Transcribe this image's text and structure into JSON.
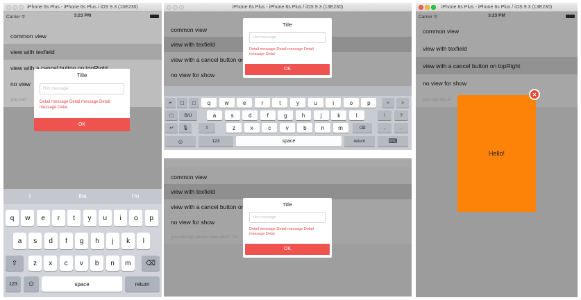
{
  "window_title": "iPhone 6s Plus - iPhone 6s Plus / iOS 9.3 (13E230)",
  "status": {
    "carrier": "Carrier ᯤ",
    "time": "3:23 PM"
  },
  "list_items": [
    "common view",
    "view with texfield",
    "view with a cancel button on topRight",
    "no view for show"
  ],
  "list_truncated": {
    "panel1_row3": "view with a cancel button on topRight",
    "panel2_row3": "view with a cancel button on t",
    "panel1_row4": "no view",
    "panel3_row3": "view with a cancel button on t"
  },
  "hint_text": "you can tap above rows when I'm",
  "hint_short": {
    "panel1": "you can",
    "panel4": "you can tap at"
  },
  "alert": {
    "title": "Title",
    "placeholder": "Hint message",
    "message": "Detail message Detail message Detail message Detai",
    "ok_label": "OK"
  },
  "popup": {
    "text": "Hello!",
    "close_glyph": "✕"
  },
  "colors": {
    "accent": "#ef5350",
    "message": "#e5484d",
    "popup": "#fd8208",
    "selected_row": "#a6a6a6"
  },
  "keyboard_iphone": {
    "suggestions": [
      "I",
      "the",
      "I'm"
    ],
    "row1": [
      "q",
      "w",
      "e",
      "r",
      "t",
      "y",
      "u",
      "i",
      "o",
      "p"
    ],
    "row2": [
      "a",
      "s",
      "d",
      "f",
      "g",
      "h",
      "j",
      "k",
      "l"
    ],
    "row3": [
      "z",
      "x",
      "c",
      "v",
      "b",
      "n",
      "m"
    ],
    "shift": "⇧",
    "backspace": "⌫",
    "numbers": "123",
    "emoji": "☺",
    "space": "space",
    "return": "return"
  },
  "keyboard_ipad": {
    "row1": [
      "q",
      "w",
      "e",
      "r",
      "t",
      "y",
      "u",
      "i",
      "o",
      "p"
    ],
    "row1_left": [
      "✂",
      "▢",
      "▢"
    ],
    "row1_right": [
      "<",
      ">"
    ],
    "row2": [
      "a",
      "s",
      "d",
      "f",
      "g",
      "h",
      "j",
      "k",
      "l"
    ],
    "row2_left": [
      "▢",
      "B/U"
    ],
    "row2_right": [
      "!",
      "?"
    ],
    "row3": [
      "z",
      "x",
      "c",
      "v",
      "b",
      "n",
      "m"
    ],
    "row3_left": [
      "↩",
      "🎙",
      "⇧"
    ],
    "row3_right": [
      ",",
      "."
    ],
    "backspace": "⌫",
    "emoji": "☺",
    "numbers": "123",
    "space": "space",
    "return": "return",
    "hide": "⌨"
  }
}
